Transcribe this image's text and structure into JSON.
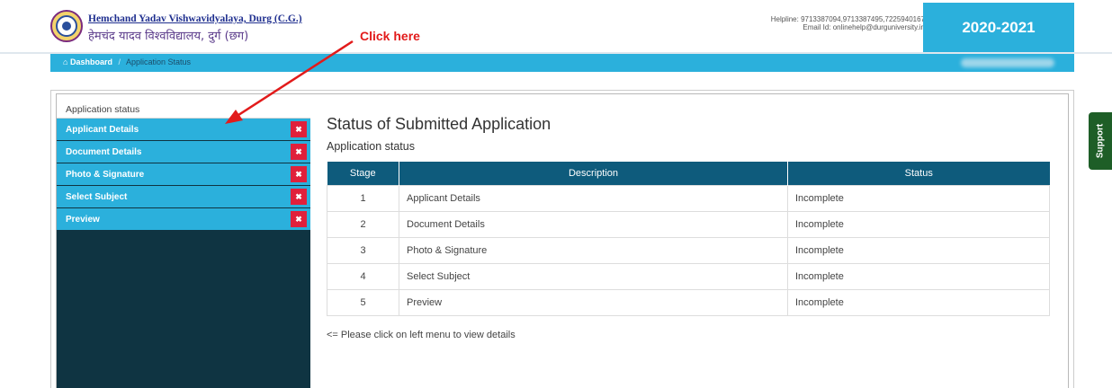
{
  "header": {
    "brand_en": "Hemchand Yadav Vishwavidyalaya, Durg (C.G.)",
    "brand_hi": "हेमचंद यादव विश्वविद्यालय, दुर्ग (छग)",
    "helpline": "Helpline: 9713387094,9713387495,7225940167",
    "email": "Email Id: onlinehelp@durguniversity.in",
    "year": "2020-2021",
    "logo_icon": "university-seal-icon"
  },
  "breadcrumb": {
    "home_icon": "home-icon",
    "home": "Dashboard",
    "separator": "/",
    "current": "Application Status"
  },
  "sidebar": {
    "title": "Application status",
    "items": [
      {
        "label": "Applicant Details",
        "status_icon": "close-icon"
      },
      {
        "label": "Document Details",
        "status_icon": "close-icon"
      },
      {
        "label": "Photo & Signature",
        "status_icon": "close-icon"
      },
      {
        "label": "Select Subject",
        "status_icon": "close-icon"
      },
      {
        "label": "Preview",
        "status_icon": "close-icon"
      }
    ]
  },
  "main": {
    "title": "Status of Submitted Application",
    "subtitle": "Application status",
    "table": {
      "headers": {
        "stage": "Stage",
        "description": "Description",
        "status": "Status"
      },
      "rows": [
        {
          "stage": "1",
          "description": "Applicant Details",
          "status": "Incomplete"
        },
        {
          "stage": "2",
          "description": "Document Details",
          "status": "Incomplete"
        },
        {
          "stage": "3",
          "description": "Photo & Signature",
          "status": "Incomplete"
        },
        {
          "stage": "4",
          "description": "Select Subject",
          "status": "Incomplete"
        },
        {
          "stage": "5",
          "description": "Preview",
          "status": "Incomplete"
        }
      ]
    },
    "hint": "<= Please click on left menu to view details"
  },
  "annotation": {
    "text": "Click here"
  },
  "support": {
    "label": "Support"
  },
  "colors": {
    "accent": "#2bb0dc",
    "sidebar_bg": "#0f3442",
    "table_header": "#0e5b7c",
    "incomplete_badge": "#e0203b",
    "annotation": "#e21b1b",
    "support": "#1e5e27"
  }
}
